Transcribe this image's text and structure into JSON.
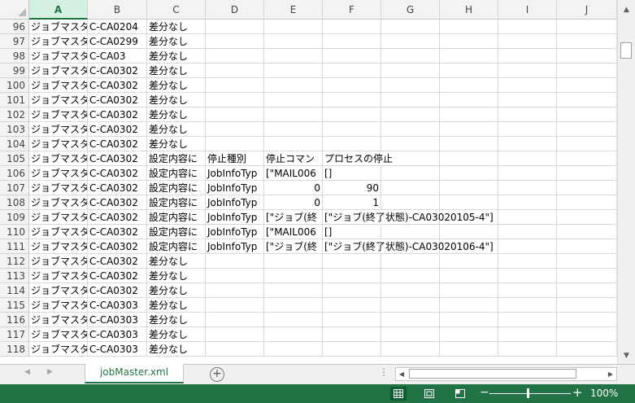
{
  "columns": [
    "A",
    "B",
    "C",
    "D",
    "E",
    "F",
    "G",
    "H",
    "I",
    "J"
  ],
  "selected_column": "A",
  "rows": [
    {
      "n": "96",
      "a": "ジョブマスタ",
      "b": "C-CA0204",
      "c": "差分なし"
    },
    {
      "n": "97",
      "a": "ジョブマスタ",
      "b": "C-CA0299",
      "c": "差分なし"
    },
    {
      "n": "98",
      "a": "ジョブマスタ",
      "b": "C-CA03",
      "c": "差分なし"
    },
    {
      "n": "99",
      "a": "ジョブマスタ",
      "b": "C-CA0302",
      "c": "差分なし"
    },
    {
      "n": "100",
      "a": "ジョブマスタ",
      "b": "C-CA0302",
      "c": "差分なし"
    },
    {
      "n": "101",
      "a": "ジョブマスタ",
      "b": "C-CA0302",
      "c": "差分なし"
    },
    {
      "n": "102",
      "a": "ジョブマスタ",
      "b": "C-CA0302",
      "c": "差分なし"
    },
    {
      "n": "103",
      "a": "ジョブマスタ",
      "b": "C-CA0302",
      "c": "差分なし"
    },
    {
      "n": "104",
      "a": "ジョブマスタ",
      "b": "C-CA0302",
      "c": "差分なし"
    },
    {
      "n": "105",
      "a": "ジョブマスタ",
      "b": "C-CA0302",
      "c": "設定内容に",
      "d": "停止種別",
      "e": "停止コマン",
      "f": "プロセスの停止",
      "fs": true
    },
    {
      "n": "106",
      "a": "ジョブマスタ",
      "b": "C-CA0302",
      "c": "設定内容に",
      "d": "JobInfoTyp",
      "e": "[\"MAIL006",
      "f": "[]"
    },
    {
      "n": "107",
      "a": "ジョブマスタ",
      "b": "C-CA0302",
      "c": "設定内容に",
      "d": "JobInfoTyp",
      "e": "0",
      "en": true,
      "f": "90",
      "fn": true
    },
    {
      "n": "108",
      "a": "ジョブマスタ",
      "b": "C-CA0302",
      "c": "設定内容に",
      "d": "JobInfoTyp",
      "e": "0",
      "en": true,
      "f": "1",
      "fn": true
    },
    {
      "n": "109",
      "a": "ジョブマスタ",
      "b": "C-CA0302",
      "c": "設定内容に",
      "d": "JobInfoTyp",
      "e": "[\"ジョブ(終",
      "f": "[\"ジョブ(終了状態)-CA03020105-4\"]",
      "fs": true
    },
    {
      "n": "110",
      "a": "ジョブマスタ",
      "b": "C-CA0302",
      "c": "設定内容に",
      "d": "JobInfoTyp",
      "e": "[\"MAIL006",
      "f": "[]"
    },
    {
      "n": "111",
      "a": "ジョブマスタ",
      "b": "C-CA0302",
      "c": "設定内容に",
      "d": "JobInfoTyp",
      "e": "[\"ジョブ(終",
      "f": "[\"ジョブ(終了状態)-CA03020106-4\"]",
      "fs": true
    },
    {
      "n": "112",
      "a": "ジョブマスタ",
      "b": "C-CA0302",
      "c": "差分なし"
    },
    {
      "n": "113",
      "a": "ジョブマスタ",
      "b": "C-CA0302",
      "c": "差分なし"
    },
    {
      "n": "114",
      "a": "ジョブマスタ",
      "b": "C-CA0302",
      "c": "差分なし"
    },
    {
      "n": "115",
      "a": "ジョブマスタ",
      "b": "C-CA0303",
      "c": "差分なし"
    },
    {
      "n": "116",
      "a": "ジョブマスタ",
      "b": "C-CA0303",
      "c": "差分なし"
    },
    {
      "n": "117",
      "a": "ジョブマスタ",
      "b": "C-CA0303",
      "c": "差分なし"
    },
    {
      "n": "118",
      "a": "ジョブマスタ",
      "b": "C-CA0303",
      "c": "差分なし"
    }
  ],
  "sheet_tab": "jobMaster.xml",
  "add_sheet_symbol": "⊕",
  "zoom": {
    "percent_label": "100%",
    "level": 100
  },
  "colors": {
    "accent": "#217346",
    "status_bar": "#217346"
  },
  "icons": [
    "select-all-corner-icon",
    "scroll-up-icon",
    "scroll-down-icon",
    "tab-prev-icon",
    "tab-next-icon",
    "add-sheet-icon",
    "scroll-left-icon",
    "scroll-right-icon",
    "normal-view-icon",
    "page-layout-view-icon",
    "page-break-view-icon",
    "zoom-out-icon",
    "zoom-in-icon"
  ]
}
